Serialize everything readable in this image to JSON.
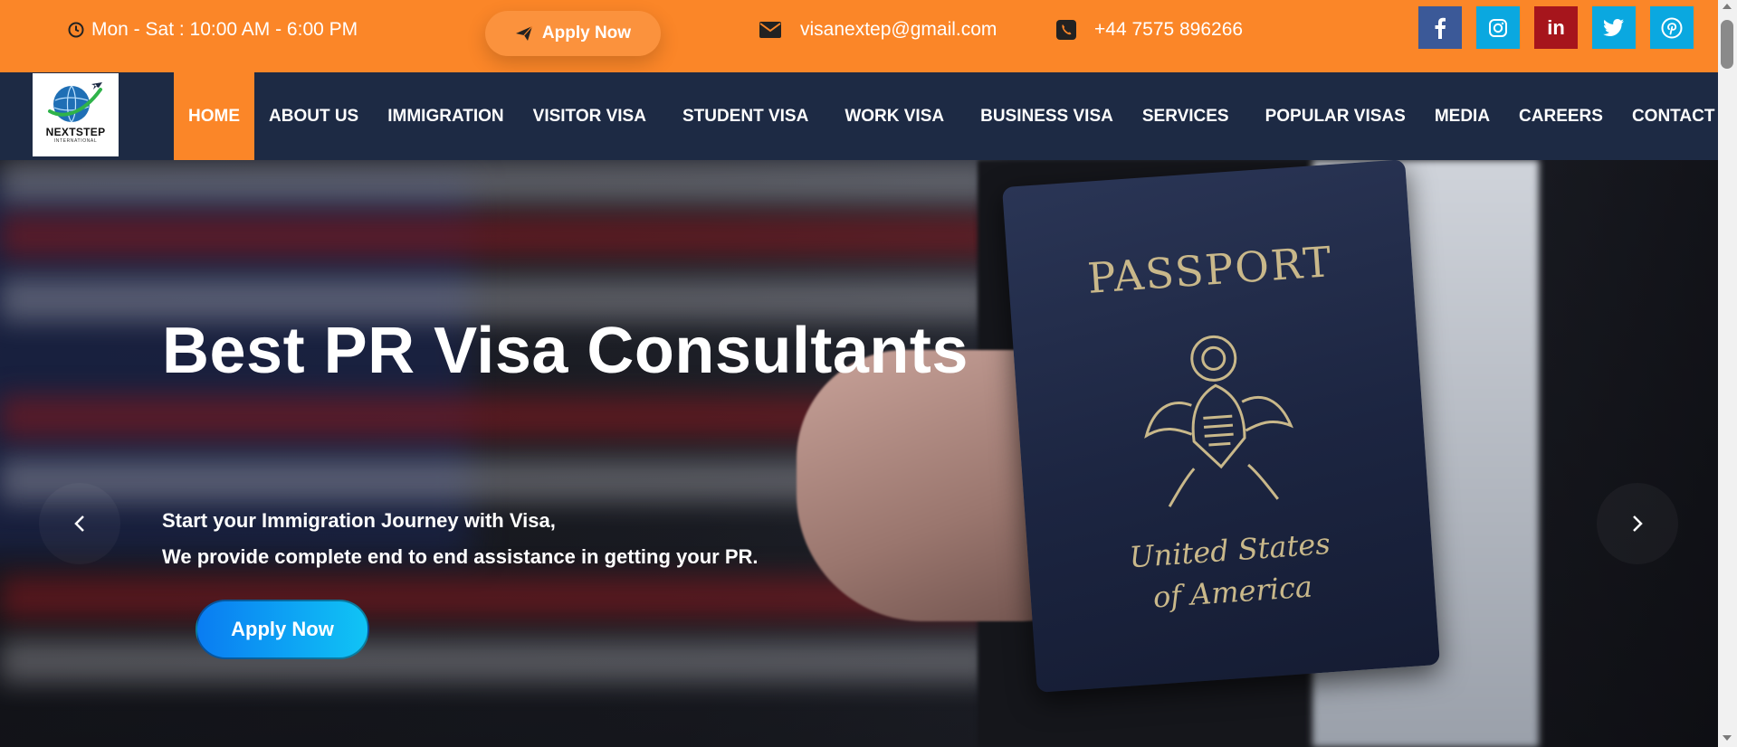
{
  "topbar": {
    "hours": "Mon - Sat : 10:00 AM - 6:00 PM",
    "apply_label": "Apply Now",
    "email": "visanextep@gmail.com",
    "phone": "+44 7575 896266",
    "social": [
      "facebook-icon",
      "instagram-icon",
      "linkedin-icon",
      "twitter-icon",
      "pinterest-icon"
    ],
    "colors": {
      "background": "#fb8628",
      "facebook": "#3b5998",
      "instagram": "#0aa8e0",
      "linkedin": "#a6151c",
      "twitter": "#0aa8e0",
      "pinterest": "#0aa8e0"
    }
  },
  "logo": {
    "name": "NEXTSTEP",
    "sub": "INTERNATIONAL"
  },
  "nav": {
    "items": [
      "HOME",
      "ABOUT US",
      "IMMIGRATION",
      "VISITOR VISA",
      "STUDENT VISA",
      "WORK VISA",
      "BUSINESS VISA",
      "SERVICES",
      "POPULAR VISAS",
      "MEDIA",
      "CAREERS",
      "CONTACT"
    ],
    "active": "HOME",
    "colors": {
      "background": "#1d2a44",
      "active": "#fb8628"
    }
  },
  "hero": {
    "title": "Best PR Visa Consultants",
    "subtitle_line1": "Start your Immigration Journey with Visa,",
    "subtitle_line2": "We provide complete end to end assistance in getting your PR.",
    "apply_label": "Apply Now",
    "passport_title": "PASSPORT",
    "passport_country_line1": "United States",
    "passport_country_line2": "of America"
  }
}
